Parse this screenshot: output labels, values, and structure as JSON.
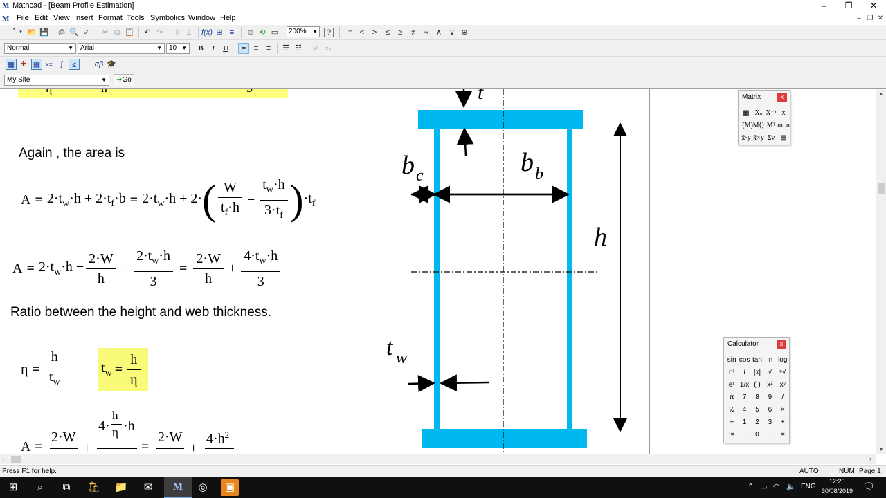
{
  "app": {
    "title": "Mathcad - [Beam Profile Estimation]",
    "icon_letter": "M"
  },
  "window_controls": [
    "–",
    "❐",
    "✕"
  ],
  "menu": [
    "File",
    "Edit",
    "View",
    "Insert",
    "Format",
    "Tools",
    "Symbolics",
    "Window",
    "Help"
  ],
  "toolbar": {
    "zoom": "200%",
    "style": "Normal",
    "font": "Arial",
    "font_size": "10",
    "bold": "B",
    "italic": "I",
    "underline": "U",
    "site": "My Site",
    "go": "Go",
    "symbols": [
      "=",
      "<",
      ">",
      "≤",
      "≥",
      "≠",
      "¬",
      "∧",
      "∨",
      "⊕"
    ]
  },
  "document": {
    "heading_area": "Again , the area is",
    "heading_ratio": "Ratio between the height and web thickness.",
    "eq1": {
      "lhs": "A",
      "t": "t",
      "w": "w",
      "f": "f",
      "W": "W",
      "h": "h",
      "b": "b",
      "two": "2",
      "three": "3"
    },
    "eq3": {
      "eta": "η",
      "h": "h",
      "t": "t",
      "w": "w"
    },
    "eq4": {
      "A": "A",
      "two": "2",
      "W": "W",
      "four": "4",
      "h": "h",
      "eta": "η",
      "sq": "2"
    },
    "figure_labels": {
      "t": "t",
      "bc": "b",
      "bc_sub": "c",
      "bb": "b",
      "bb_sub": "b",
      "h": "h",
      "tw": "t",
      "tw_sub": "w"
    },
    "figure_color": "#00b8f0"
  },
  "palettes": {
    "matrix": {
      "title": "Matrix",
      "close": "x",
      "items": [
        "▦",
        "Xₙ",
        "X⁻¹",
        "|x|",
        "f(M)",
        "M⟨⟩",
        "Mᵀ",
        "m..n",
        "x̄·ȳ",
        "x̄×ȳ",
        "Σv",
        "▤"
      ]
    },
    "calculator": {
      "title": "Calculator",
      "close": "x",
      "items": [
        "sin",
        "cos",
        "tan",
        "ln",
        "log",
        "n!",
        "i",
        "|x|",
        "√",
        "ⁿ√",
        "eˣ",
        "1/x",
        "( )",
        "x²",
        "xʸ",
        "π",
        "7",
        "8",
        "9",
        "/",
        "½",
        "4",
        "5",
        "6",
        "×",
        "÷",
        "1",
        "2",
        "3",
        "+",
        ":=",
        ".",
        "0",
        "−",
        "="
      ]
    }
  },
  "status": {
    "help": "Press F1 for help.",
    "auto": "AUTO",
    "num": "NUM",
    "page": "Page 1"
  },
  "taskbar": {
    "lang": "ENG",
    "time": "12:25",
    "date": "30/08/2019"
  }
}
